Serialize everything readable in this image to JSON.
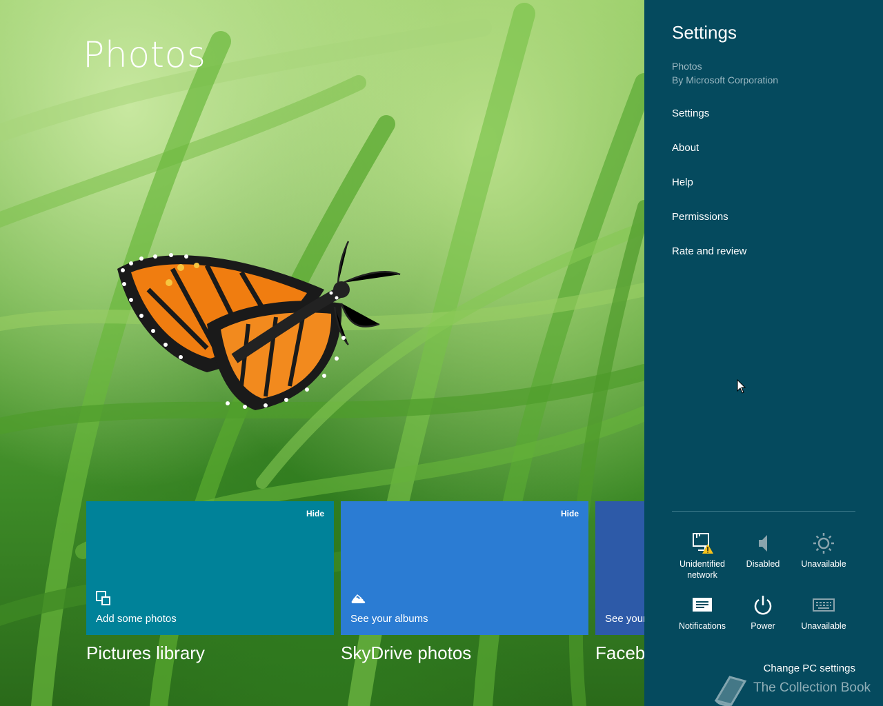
{
  "app": {
    "title": "Photos"
  },
  "tiles": [
    {
      "hide_label": "Hide",
      "label": "Add some photos",
      "caption": "Pictures library",
      "color": "#008299",
      "icon": "devices-icon"
    },
    {
      "hide_label": "Hide",
      "label": "See your albums",
      "caption": "SkyDrive photos",
      "color": "#2b7cd3",
      "icon": "skydrive-cloud-icon"
    },
    {
      "hide_label": "",
      "label": "See your",
      "caption": "Faceb",
      "color": "#2d5aa8",
      "icon": ""
    }
  ],
  "charm": {
    "title": "Settings",
    "app_name": "Photos",
    "publisher": "By Microsoft Corporation",
    "background_color": "#054a5e",
    "menu": [
      "Settings",
      "About",
      "Help",
      "Permissions",
      "Rate and review"
    ],
    "quick_settings": [
      {
        "label": "Unidentified network",
        "icon": "network-warning-icon"
      },
      {
        "label": "Disabled",
        "icon": "speaker-icon"
      },
      {
        "label": "Unavailable",
        "icon": "brightness-icon"
      },
      {
        "label": "Notifications",
        "icon": "notifications-icon"
      },
      {
        "label": "Power",
        "icon": "power-icon"
      },
      {
        "label": "Unavailable",
        "icon": "keyboard-icon"
      }
    ],
    "change_pc_settings": "Change PC settings"
  },
  "watermark": {
    "text": "The Collection Book",
    "icon": "book-icon"
  }
}
